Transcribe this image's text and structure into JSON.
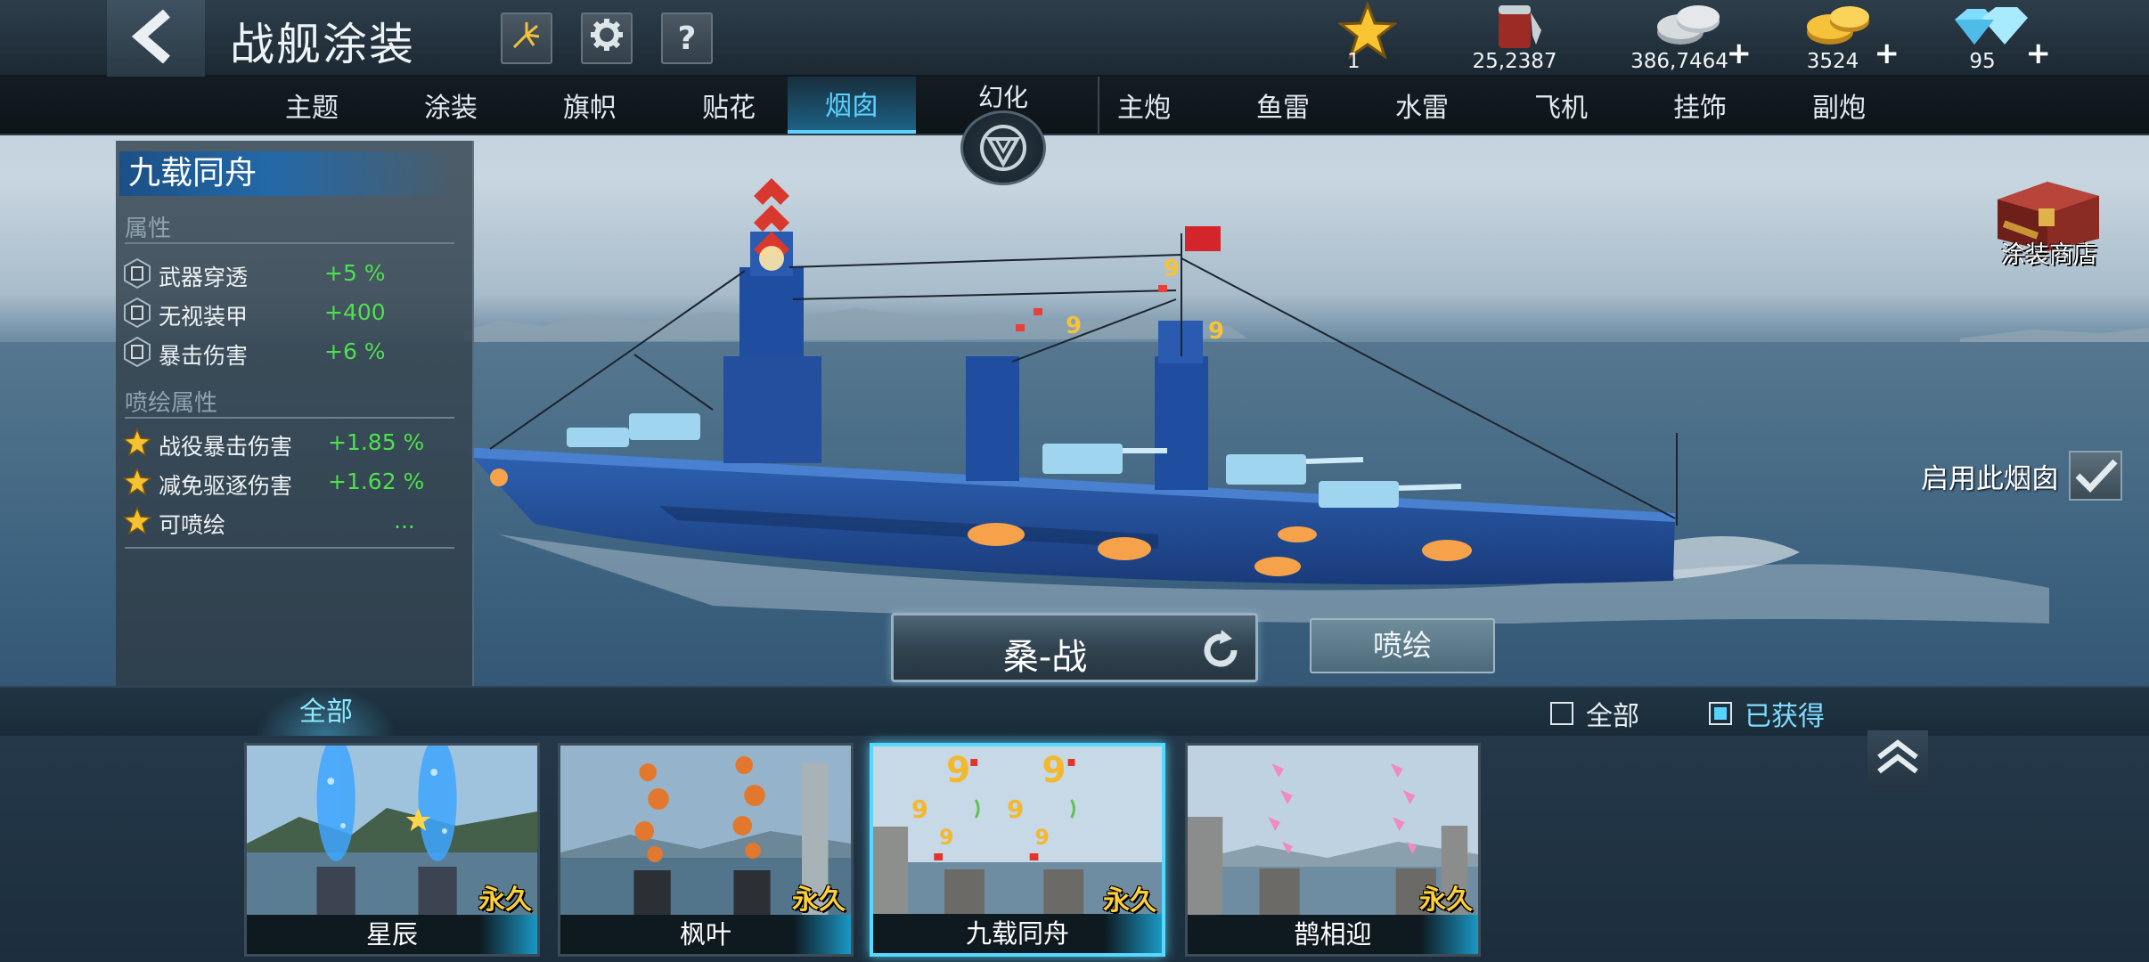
{
  "header": {
    "title": "战舰涂装",
    "currencies": [
      {
        "icon": "star-icon",
        "value": "1",
        "has_plus": false
      },
      {
        "icon": "paint-bucket-icon",
        "value": "25,2387",
        "has_plus": false
      },
      {
        "icon": "silver-coins-icon",
        "value": "386,7464",
        "has_plus": true
      },
      {
        "icon": "gold-coins-icon",
        "value": "3524",
        "has_plus": true
      },
      {
        "icon": "diamond-icon",
        "value": "95",
        "has_plus": true
      }
    ],
    "tool_buttons": [
      {
        "icon": "fireworks-icon"
      },
      {
        "icon": "gear-icon"
      },
      {
        "icon": "help-icon",
        "glyph": "?"
      }
    ]
  },
  "tabs": {
    "left": [
      {
        "label": "主题",
        "active": false
      },
      {
        "label": "涂装",
        "active": false
      },
      {
        "label": "旗帜",
        "active": false
      },
      {
        "label": "贴花",
        "active": false
      },
      {
        "label": "烟囱",
        "active": true
      }
    ],
    "center": {
      "label": "幻化",
      "icon": "transmute-icon"
    },
    "right": [
      {
        "label": "主炮"
      },
      {
        "label": "鱼雷"
      },
      {
        "label": "水雷"
      },
      {
        "label": "飞机"
      },
      {
        "label": "挂饰"
      },
      {
        "label": "副炮"
      }
    ]
  },
  "attributes": {
    "title": "九载同舟",
    "section_basic": "属性",
    "basic": [
      {
        "name": "武器穿透",
        "value": "+5 %"
      },
      {
        "name": "无视装甲",
        "value": "+400"
      },
      {
        "name": "暴击伤害",
        "value": "+6 %"
      }
    ],
    "section_spray": "喷绘属性",
    "spray": [
      {
        "name": "战役暴击伤害",
        "value": "+1.85 %"
      },
      {
        "name": "减免驱逐伤害",
        "value": "+1.62 %"
      },
      {
        "name": "可喷绘",
        "value": "..."
      }
    ]
  },
  "center": {
    "skin_name": "桑-战",
    "spray_button": "喷绘"
  },
  "right": {
    "shop_label": "涂装商店",
    "enable_label": "启用此烟囱",
    "enable_checked": true
  },
  "filter": {
    "tab_all": "全部",
    "check_all": {
      "label": "全部",
      "checked": false
    },
    "check_owned": {
      "label": "已获得",
      "checked": true
    }
  },
  "cards": [
    {
      "name": "星辰",
      "tag": "永久",
      "theme": "blue-sparkle",
      "selected": false
    },
    {
      "name": "枫叶",
      "tag": "永久",
      "theme": "orange-leaves",
      "selected": false
    },
    {
      "name": "九载同舟",
      "tag": "永久",
      "theme": "gold-nine",
      "selected": true
    },
    {
      "name": "鹊相迎",
      "tag": "永久",
      "theme": "pink-birds",
      "selected": false
    }
  ],
  "colors": {
    "accent_cyan": "#5cd0ff",
    "stat_green": "#4ee04e",
    "tag_gold": "#ffcf3a",
    "title_blue": "#2369a8"
  }
}
